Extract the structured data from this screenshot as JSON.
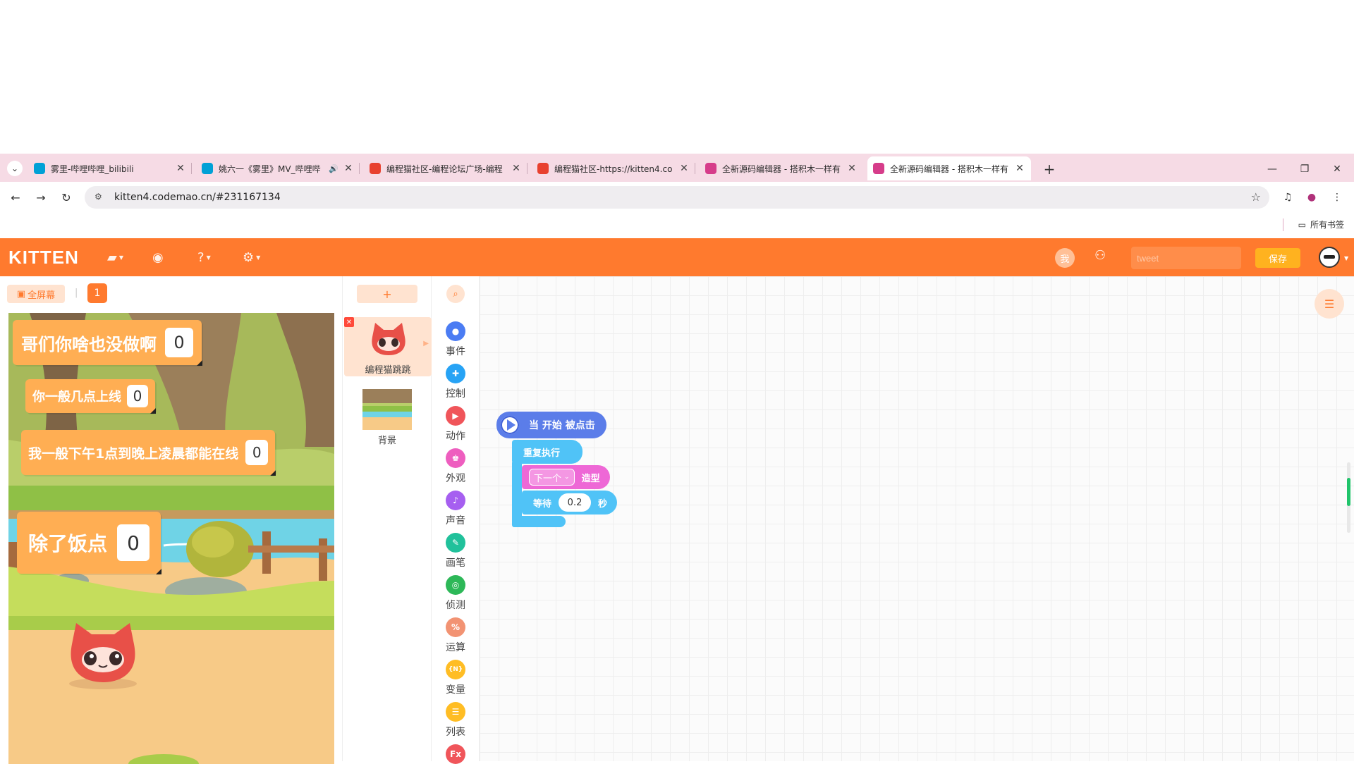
{
  "browser": {
    "tabs": [
      {
        "title": "雾里-哔哩哔哩_bilibili",
        "favicon_color": "#00a1d6",
        "audio": false
      },
      {
        "title": "姚六一《雾里》MV_哔哩哔",
        "favicon_color": "#00a1d6",
        "audio": true
      },
      {
        "title": "编程猫社区-编程论坛广场-编程",
        "favicon_color": "#e8412f",
        "audio": false
      },
      {
        "title": "编程猫社区-https://kitten4.co",
        "favicon_color": "#e8412f",
        "audio": false
      },
      {
        "title": "全新源码编辑器 - 搭积木一样有",
        "favicon_color": "#d63c8a",
        "audio": false
      },
      {
        "title": "全新源码编辑器 - 搭积木一样有",
        "favicon_color": "#d63c8a",
        "audio": false
      }
    ],
    "active_tab": 5,
    "url": "kitten4.codemao.cn/#231167134",
    "bookmarks_label": "所有书签",
    "accent": "#f6dbe5"
  },
  "app": {
    "logo": "KITTEN",
    "me_label": "我",
    "tweet_placeholder": "tweet",
    "save_label": "保存",
    "brand_color": "#ff7a2e"
  },
  "stage": {
    "fullscreen_label": "全屏幕",
    "scene_number": "1",
    "monitors": [
      {
        "label": "哥们你啥也没做啊",
        "value": "0"
      },
      {
        "label": "你一般几点上线",
        "value": "0"
      },
      {
        "label": "我一般下午1点到晚上凌晨都能在线",
        "value": "0"
      },
      {
        "label": "除了饭点",
        "value": "0"
      }
    ]
  },
  "sprites": {
    "add_label": "+",
    "items": [
      {
        "name": "编程猫跳跳"
      }
    ],
    "background_label": "背景"
  },
  "palette": {
    "categories": [
      {
        "name": "事件",
        "color": "#4b7cf3",
        "icon": "event-icon"
      },
      {
        "name": "控制",
        "color": "#27a3f5",
        "icon": "control-icon"
      },
      {
        "name": "动作",
        "color": "#f0555a",
        "icon": "motion-icon"
      },
      {
        "name": "外观",
        "color": "#ee5ebf",
        "icon": "looks-icon"
      },
      {
        "name": "声音",
        "color": "#a65ff0",
        "icon": "sound-icon"
      },
      {
        "name": "画笔",
        "color": "#21c19b",
        "icon": "pen-icon"
      },
      {
        "name": "侦测",
        "color": "#2db858",
        "icon": "sensing-icon"
      },
      {
        "name": "运算",
        "color": "#f29373",
        "icon": "operator-icon"
      },
      {
        "name": "变量",
        "color": "#ffbd24",
        "icon": "variable-icon"
      },
      {
        "name": "列表",
        "color": "#ffbd24",
        "icon": "list-icon"
      },
      {
        "name": "",
        "color": "#f0555a",
        "icon": "function-icon"
      }
    ]
  },
  "script": {
    "hat_label": "当 开始 被点击",
    "repeat_label": "重复执行",
    "costume_dropdown": "下一个",
    "costume_label": "造型",
    "wait_label": "等待",
    "wait_value": "0.2",
    "wait_unit": "秒"
  }
}
